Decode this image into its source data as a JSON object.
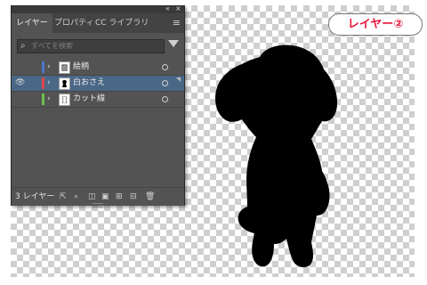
{
  "canvas": {
    "badge_label": "レイヤー②",
    "badge_color": "#e8183c",
    "silhouette_name": "dog-silhouette"
  },
  "panel": {
    "tabs": [
      {
        "label": "レイヤー",
        "active": true
      },
      {
        "label": "プロパティ",
        "active": false
      },
      {
        "label": "CC ライブラリ",
        "active": false
      }
    ],
    "collapse_icon": "«",
    "close_icon": "×",
    "menu_icon": "≡",
    "search_placeholder": "すべてを検索",
    "layers": [
      {
        "name": "絵柄",
        "visible": false,
        "color": "#4a78c8",
        "selected": false
      },
      {
        "name": "白おさえ",
        "visible": true,
        "color": "#e0464a",
        "selected": true
      },
      {
        "name": "カット線",
        "visible": false,
        "color": "#6fbf4a",
        "selected": false
      }
    ],
    "footer": {
      "layer_count": "3 レイヤー"
    }
  }
}
